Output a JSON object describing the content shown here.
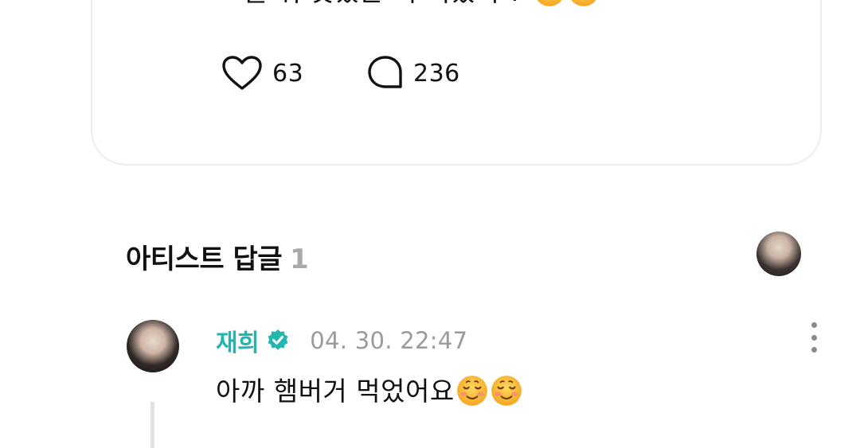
{
  "post": {
    "text": "오늘 뭐 맛있는 거 먹었니 ?",
    "emojis": [
      "smiling-face",
      "smiling-face"
    ],
    "like_count": "63",
    "comment_count": "236"
  },
  "artist_replies": {
    "title": "아티스트 답글",
    "count": "1"
  },
  "reply": {
    "author": "재희",
    "timestamp": "04. 30. 22:47",
    "text": "아까 햄버거 먹었어요",
    "emojis": [
      "smiling-face",
      "smiling-face"
    ]
  },
  "colors": {
    "accent": "#21b6b0",
    "muted": "#9b9b9b",
    "card_border": "#ececec"
  }
}
